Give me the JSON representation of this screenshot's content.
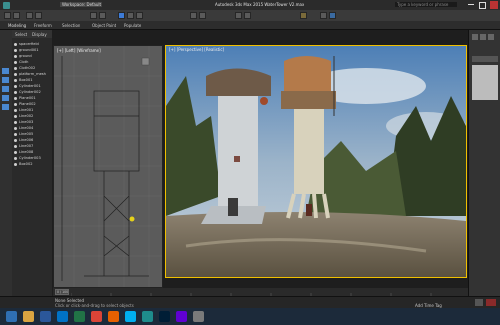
{
  "app": {
    "title": "Autodesk 3ds Max 2015   WaterTower V2.max",
    "workspace": "Workspace: Default",
    "search_placeholder": "Type a keyword or phrase"
  },
  "ribbon": {
    "tabs": [
      "Modeling",
      "Freeform",
      "Selection",
      "Object Paint",
      "Populate"
    ]
  },
  "scene_explorer": {
    "header_tabs": [
      "Select",
      "Display"
    ],
    "items": [
      "spacerfield",
      "ground001",
      "ground",
      "Cloth",
      "Cloth002",
      "platform_mesh",
      "Box001",
      "Cylinder001",
      "Cylinder002",
      "Plane001",
      "Plane002",
      "Line001",
      "Line002",
      "Line003",
      "Line004",
      "Line005",
      "Line006",
      "Line007",
      "Line008",
      "Cylinder003",
      "Box002"
    ]
  },
  "viewports": {
    "left_label": "[+] [Left] [Wireframe]",
    "right_label": "[+] [Perspective] [Realistic]"
  },
  "timeline": {
    "frame_label": "0 / 100"
  },
  "status": {
    "selection": "None Selected",
    "prompt": "Click or click-and-drag to select objects",
    "add_time_tag": "Add Time Tag"
  },
  "taskbar": {
    "icons": [
      {
        "name": "start-icon",
        "color": "#2f6fb3"
      },
      {
        "name": "explorer-icon",
        "color": "#d9a441"
      },
      {
        "name": "word-icon",
        "color": "#2b579a"
      },
      {
        "name": "outlook-icon",
        "color": "#0072c6"
      },
      {
        "name": "excel-icon",
        "color": "#217346"
      },
      {
        "name": "chrome-icon",
        "color": "#db4437"
      },
      {
        "name": "firefox-icon",
        "color": "#e66000"
      },
      {
        "name": "skype-icon",
        "color": "#00aff0"
      },
      {
        "name": "3dsmax-icon",
        "color": "#1e8c8c"
      },
      {
        "name": "photoshop-icon",
        "color": "#001e36"
      },
      {
        "name": "yahoo-icon",
        "color": "#6001d2"
      },
      {
        "name": "misc-icon",
        "color": "#7a7a7a"
      }
    ]
  }
}
